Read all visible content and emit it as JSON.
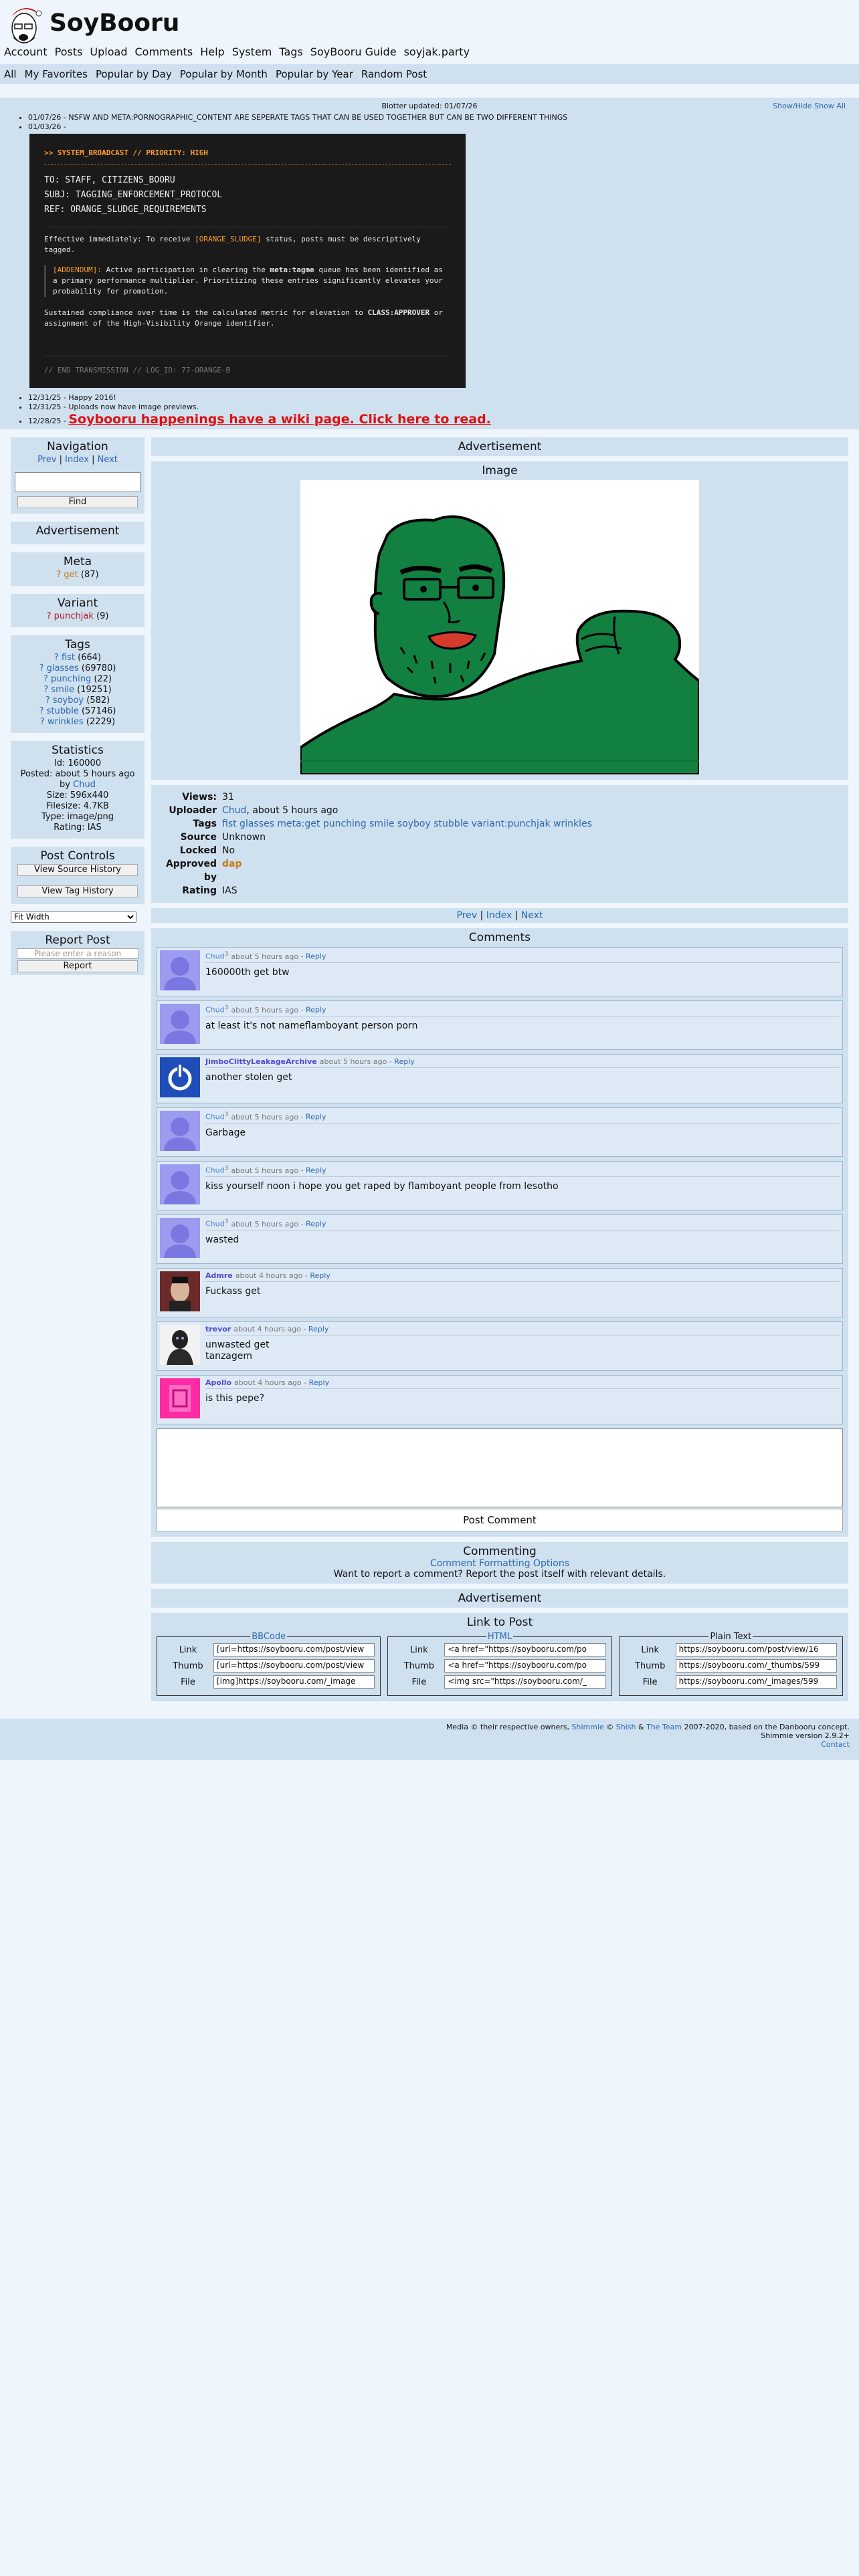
{
  "header": {
    "site_title": "SoyBooru",
    "nav": [
      "Account",
      "Posts",
      "Upload",
      "Comments",
      "Help",
      "System",
      "Tags",
      "SoyBooru Guide",
      "soyjak.party"
    ]
  },
  "subnav": [
    "All",
    "My Favorites",
    "Popular by Day",
    "Popular by Month",
    "Popular by Year",
    "Random Post"
  ],
  "blotter": {
    "updated": "Blotter updated: 01/07/26",
    "links": "Show/Hide Show All",
    "entries": [
      "01/07/26 - NSFW AND META:PORNOGRAPHIC_CONTENT ARE SEPERATE TAGS THAT CAN BE USED TOGETHER BUT CAN BE TWO DIFFERENT THINGS",
      "01/03/26 -"
    ],
    "broadcast": {
      "header": ">> SYSTEM_BROADCAST // PRIORITY: HIGH",
      "to": "TO: STAFF, CITIZENS_BOORU",
      "subj": "SUBJ: TAGGING_ENFORCEMENT_PROTOCOL",
      "ref": "REF: ORANGE_SLUDGE_REQUIREMENTS",
      "p1_pre": "Effective immediately: To receive ",
      "p1_hl": "[ORANGE_SLUDGE]",
      "p1_post": " status, posts must be descriptively tagged.",
      "addendum_label": "[ADDENDUM]:",
      "addendum_pre": " Active participation in clearing the ",
      "addendum_tag": "meta:tagme",
      "addendum_post": " queue has been identified as a primary performance multiplier. Prioritizing these entries significantly elevates your probability for promotion.",
      "p3_pre": "Sustained compliance over time is the calculated metric for elevation to ",
      "p3_class": "CLASS:APPROVER",
      "p3_post": " or assignment of the High-Visibility Orange identifier.",
      "end": "// END TRANSMISSION // LOG_ID: 77-ORANGE-B"
    },
    "after": [
      "12/31/25 - Happy 2016!",
      "12/31/25 - Uploads now have image previews.",
      "12/28/25 -"
    ],
    "wiki_banner": "Soybooru happenings have a wiki page. Click here to read."
  },
  "sidebar": {
    "navigation": {
      "title": "Navigation",
      "prev": "Prev",
      "index": "Index",
      "next": "Next",
      "find": "Find"
    },
    "advertisement": "Advertisement",
    "meta": {
      "title": "Meta",
      "q": "?",
      "tag": "get",
      "count": "(87)"
    },
    "variant": {
      "title": "Variant",
      "q": "?",
      "tag": "punchjak",
      "count": "(9)"
    },
    "tags": {
      "title": "Tags",
      "items": [
        {
          "name": "fist",
          "count": "(664)"
        },
        {
          "name": "glasses",
          "count": "(69780)"
        },
        {
          "name": "punching",
          "count": "(22)"
        },
        {
          "name": "smile",
          "count": "(19251)"
        },
        {
          "name": "soyboy",
          "count": "(582)"
        },
        {
          "name": "stubble",
          "count": "(57146)"
        },
        {
          "name": "wrinkles",
          "count": "(2229)"
        }
      ]
    },
    "statistics": {
      "title": "Statistics",
      "id": "Id: 160000",
      "posted": "Posted: about 5 hours ago",
      "by": "by",
      "by_user": "Chud",
      "size": "Size: 596x440",
      "filesize": "Filesize: 4.7KB",
      "type": "Type: image/png",
      "rating": "Rating: IAS"
    },
    "post_controls": {
      "title": "Post Controls",
      "source_history": "View Source History",
      "tag_history": "View Tag History",
      "fit": "Fit Width"
    },
    "report": {
      "title": "Report Post",
      "placeholder": "Please enter a reason",
      "button": "Report"
    }
  },
  "main": {
    "advertisement": "Advertisement",
    "image_title": "Image",
    "info": {
      "views_label": "Views:",
      "views": "31",
      "uploader_label": "Uploader",
      "uploader": "Chud",
      "uploaded": ", about 5 hours ago",
      "tags_label": "Tags",
      "tags": "fist glasses meta:get punching smile soyboy stubble variant:punchjak wrinkles",
      "source_label": "Source",
      "source": "Unknown",
      "locked_label": "Locked",
      "locked": "No",
      "approved_label": "Approved by",
      "approved": "dap",
      "rating_label": "Rating",
      "rating": "IAS"
    },
    "pager": {
      "prev": "Prev",
      "index": "Index",
      "next": "Next"
    },
    "comments_title": "Comments",
    "comments": [
      {
        "user": "Chud",
        "sup": "3",
        "time": "about 5 hours ago",
        "reply": "Reply",
        "text": "160000th get btw",
        "avatar": "soy"
      },
      {
        "user": "Chud",
        "sup": "3",
        "time": "about 5 hours ago",
        "reply": "Reply",
        "text": "at least it's not nameflamboyant person porn",
        "avatar": "soy"
      },
      {
        "user": "JimboClittyLeakageArchive",
        "sup": "",
        "time": "about 5 hours ago",
        "reply": "Reply",
        "text": "another stolen get",
        "avatar": "power"
      },
      {
        "user": "Chud",
        "sup": "3",
        "time": "about 5 hours ago",
        "reply": "Reply",
        "text": "Garbage",
        "avatar": "soy"
      },
      {
        "user": "Chud",
        "sup": "3",
        "time": "about 5 hours ago",
        "reply": "Reply",
        "text": "kiss yourself noon i hope you get raped by flamboyant people from lesotho",
        "avatar": "soy"
      },
      {
        "user": "Chud",
        "sup": "3",
        "time": "about 5 hours ago",
        "reply": "Reply",
        "text": "wasted",
        "avatar": "soy"
      },
      {
        "user": "Admre",
        "sup": "",
        "time": "about 4 hours ago",
        "reply": "Reply",
        "text": "Fuckass get",
        "avatar": "photo"
      },
      {
        "user": "trevor",
        "sup": "",
        "time": "about 4 hours ago",
        "reply": "Reply",
        "text": "unwasted get",
        "text2": "tanzagem",
        "avatar": "mask"
      },
      {
        "user": "Apollo",
        "sup": "",
        "time": "about 4 hours ago",
        "reply": "Reply",
        "text": "is this pepe?",
        "avatar": "pink"
      }
    ],
    "post_comment": "Post Comment",
    "commenting": {
      "title": "Commenting",
      "link": "Comment Formatting Options",
      "text": "Want to report a comment? Report the post itself with relevant details."
    },
    "advertisement2": "Advertisement",
    "link_to_post": {
      "title": "Link to Post",
      "labels": {
        "link": "Link",
        "thumb": "Thumb",
        "file": "File"
      },
      "bbcode": {
        "legend": "BBCode",
        "link": "[url=https://soybooru.com/post/view",
        "thumb": "[url=https://soybooru.com/post/view",
        "file": "[img]https://soybooru.com/_image"
      },
      "html": {
        "legend": "HTML",
        "link": "<a href=\"https://soybooru.com/po",
        "thumb": "<a href=\"https://soybooru.com/po",
        "file": "<img src=\"https://soybooru.com/_"
      },
      "plain": {
        "legend": "Plain Text",
        "link": "https://soybooru.com/post/view/16",
        "thumb": "https://soybooru.com/_thumbs/599",
        "file": "https://soybooru.com/_images/599"
      }
    }
  },
  "footer": {
    "line1_pre": "Media © their respective owners, ",
    "shimmie": "Shimmie",
    "copy": " © ",
    "shish": "Shish",
    "amp": " & ",
    "team": "The Team",
    "line1_post": " 2007-2020, based on the Danbooru concept.",
    "version": "Shimmie version 2.9.2+",
    "contact": "Contact"
  }
}
